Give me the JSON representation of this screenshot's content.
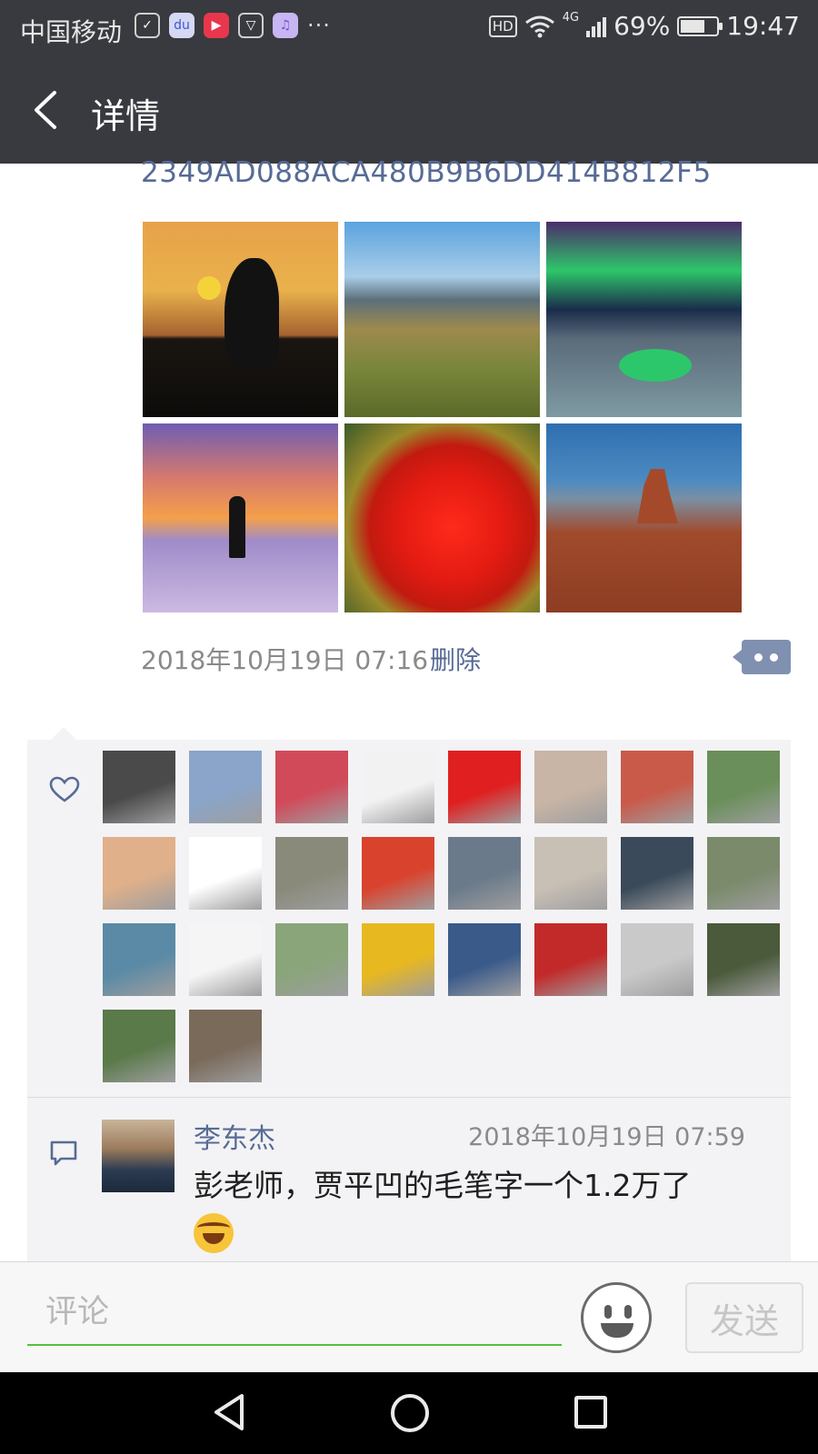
{
  "status_bar": {
    "carrier": "中国移动",
    "dots": "···",
    "hd": "HD",
    "network": "4G",
    "battery": "69%",
    "time": "19:47"
  },
  "nav": {
    "title": "详情"
  },
  "post": {
    "text": "2349AD088ACA480B9B6DD414B812F5",
    "photos": [
      "sunset-crane",
      "hill-town",
      "aurora-lake",
      "silhouette-sunset",
      "red-maple-leaves",
      "desert-butte"
    ],
    "timestamp": "2018年10月19日 07:16",
    "delete_label": "删除"
  },
  "likes": {
    "icon": "heart-icon",
    "avatar_colors": [
      "#4a4a4a",
      "#8aa5c9",
      "#d14a5a",
      "#f2f2f2",
      "#e02020",
      "#c9b5a5",
      "#c95a4a",
      "#6a8f5a",
      "#e0b08a",
      "#ffffff",
      "#8a8a7a",
      "#d9432e",
      "#6a7a8a",
      "#c9c0b5",
      "#3a4a5a",
      "#7a8a6a",
      "#5a8aa5",
      "#f5f5f5",
      "#8aa57a",
      "#e8b820",
      "#3a5a8a",
      "#c22a2a",
      "#c9c9c9",
      "#4a5a3a",
      "#5a7a4a",
      "#7a6a5a"
    ]
  },
  "comment": {
    "icon": "comment-icon",
    "author": "李东杰",
    "time": "2018年10月19日 07:59",
    "text": "彭老师，贾平凹的毛笔字一个1.2万了",
    "emoji": "laughing-crying-emoji"
  },
  "input_bar": {
    "placeholder": "评论",
    "send_label": "发送"
  }
}
